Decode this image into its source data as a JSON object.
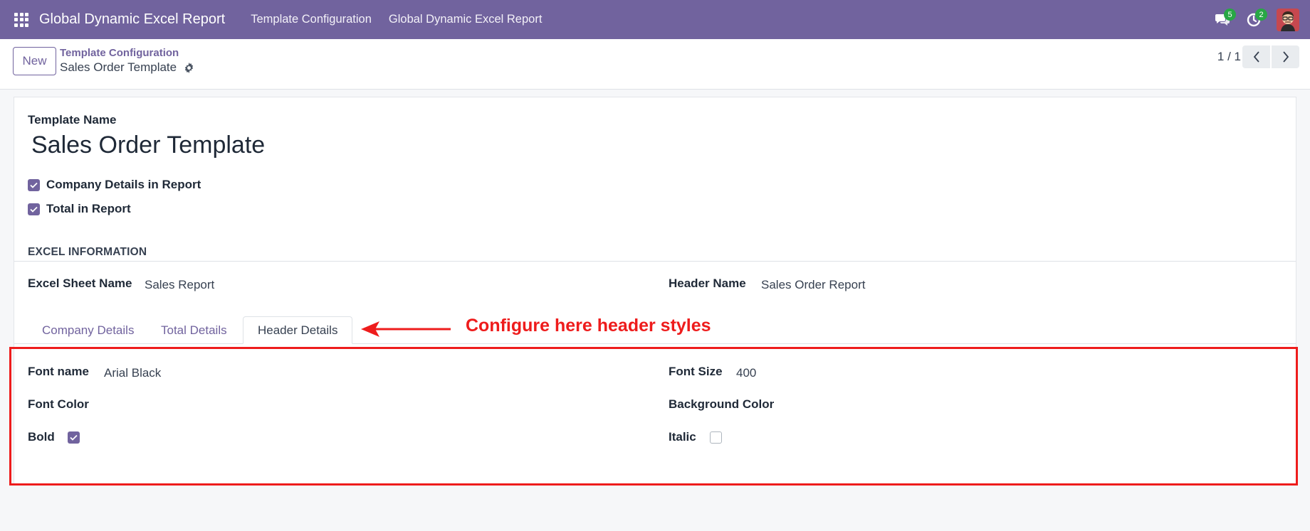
{
  "navbar": {
    "brand": "Global Dynamic Excel Report",
    "menus": [
      "Template Configuration",
      "Global Dynamic Excel Report"
    ],
    "messages_count": "5",
    "activities_count": "2",
    "bg_color": "#71639e"
  },
  "control": {
    "new_label": "New",
    "breadcrumb": "Template Configuration",
    "record_title": "Sales Order Template",
    "pager": "1 / 1"
  },
  "form": {
    "template_name_label": "Template Name",
    "template_name": "Sales Order Template",
    "company_details_label": "Company Details in Report",
    "total_label": "Total in Report",
    "section_title": "EXCEL INFORMATION",
    "sheet_name_label": "Excel Sheet Name",
    "sheet_name": "Sales Report",
    "header_name_label": "Header Name",
    "header_name": "Sales Order Report",
    "tabs": [
      "Company Details",
      "Total Details",
      "Header Details"
    ],
    "font_name_label": "Font name",
    "font_name": "Arial Black",
    "font_size_label": "Font Size",
    "font_size": "400",
    "font_color_label": "Font Color",
    "bg_color_label": "Background Color",
    "bold_label": "Bold",
    "italic_label": "Italic"
  },
  "annotation": {
    "text": "Configure here header styles",
    "color": "#ee1c1c"
  }
}
